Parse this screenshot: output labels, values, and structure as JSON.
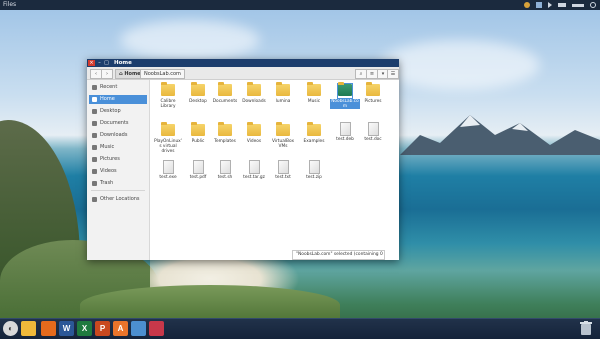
{
  "topbar": {
    "title": "Files"
  },
  "window": {
    "title": "Home",
    "breadcrumbs": [
      {
        "label": "Home",
        "active": true
      },
      {
        "label": "NoobsLab.com",
        "active": false
      }
    ],
    "sidebar": [
      {
        "label": "Recent",
        "icon": "clock-icon",
        "selected": false
      },
      {
        "label": "Home",
        "icon": "home-icon",
        "selected": true
      },
      {
        "label": "Desktop",
        "icon": "desktop-icon",
        "selected": false
      },
      {
        "label": "Documents",
        "icon": "documents-icon",
        "selected": false
      },
      {
        "label": "Downloads",
        "icon": "download-icon",
        "selected": false
      },
      {
        "label": "Music",
        "icon": "music-icon",
        "selected": false
      },
      {
        "label": "Pictures",
        "icon": "pictures-icon",
        "selected": false
      },
      {
        "label": "Videos",
        "icon": "videos-icon",
        "selected": false
      },
      {
        "label": "Trash",
        "icon": "trash-icon",
        "selected": false
      },
      {
        "label": "Other Locations",
        "icon": "plus-icon",
        "selected": false
      }
    ],
    "files": [
      {
        "name": "Calibre Library",
        "type": "folder"
      },
      {
        "name": "Desktop",
        "type": "folder"
      },
      {
        "name": "Documents",
        "type": "folder"
      },
      {
        "name": "Downloads",
        "type": "folder"
      },
      {
        "name": "lumina",
        "type": "folder"
      },
      {
        "name": "Music",
        "type": "folder"
      },
      {
        "name": "NoobsLab.com",
        "type": "folder",
        "selected": true
      },
      {
        "name": "Pictures",
        "type": "folder"
      },
      {
        "name": "PlayOnLinux's virtual drives",
        "type": "folder"
      },
      {
        "name": "Public",
        "type": "folder"
      },
      {
        "name": "Templates",
        "type": "folder"
      },
      {
        "name": "Videos",
        "type": "folder"
      },
      {
        "name": "VirtualBox VMs",
        "type": "folder"
      },
      {
        "name": "Examples",
        "type": "folder"
      },
      {
        "name": "test.deb",
        "type": "file"
      },
      {
        "name": "test.doc",
        "type": "file"
      },
      {
        "name": "test.exe",
        "type": "file"
      },
      {
        "name": "test.pdf",
        "type": "file"
      },
      {
        "name": "test.sh",
        "type": "file"
      },
      {
        "name": "test.tar.gz",
        "type": "file"
      },
      {
        "name": "test.txt",
        "type": "file"
      },
      {
        "name": "test.zip",
        "type": "file"
      }
    ],
    "status": "\"NoobsLab.com\" selected (containing 0 items)"
  },
  "taskbar": {
    "apps": [
      {
        "name": "menu",
        "glyph": "◐",
        "color": "#d9d9d9"
      },
      {
        "name": "files",
        "glyph": "",
        "color": "#f0b93a"
      },
      {
        "name": "firefox",
        "glyph": "",
        "color": "#e56a1c"
      },
      {
        "name": "word",
        "glyph": "W",
        "color": "#2b5797"
      },
      {
        "name": "excel",
        "glyph": "X",
        "color": "#1f7a3f"
      },
      {
        "name": "powerpoint",
        "glyph": "P",
        "color": "#c9491f"
      },
      {
        "name": "software-center",
        "glyph": "A",
        "color": "#e9742b"
      },
      {
        "name": "display",
        "glyph": "",
        "color": "#4c8fd0"
      },
      {
        "name": "calendar",
        "glyph": "",
        "color": "#c8384a"
      }
    ]
  }
}
